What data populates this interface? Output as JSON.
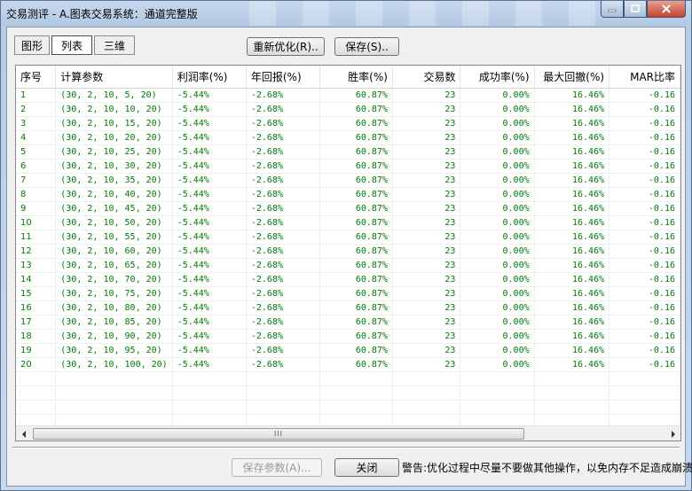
{
  "window": {
    "title": "交易测评 - A.图表交易系统：通道完整版"
  },
  "tabs": [
    {
      "label": "图形",
      "active": false
    },
    {
      "label": "列表",
      "active": true
    },
    {
      "label": "三维",
      "active": false
    }
  ],
  "toolbar": {
    "reoptimize_label": "重新优化(R)..",
    "save_label": "保存(S).."
  },
  "table": {
    "columns": [
      "序号",
      "计算参数",
      "利润率(%)",
      "年回报(%)",
      "胜率(%)",
      "交易数",
      "成功率(%)",
      "最大回撤(%)",
      "MAR比率"
    ],
    "rows": [
      [
        "1",
        "(30, 2, 10, 5, 20)",
        "-5.44%",
        "-2.68%",
        "60.87%",
        "23",
        "0.00%",
        "16.46%",
        "-0.16"
      ],
      [
        "2",
        "(30, 2, 10, 10, 20)",
        "-5.44%",
        "-2.68%",
        "60.87%",
        "23",
        "0.00%",
        "16.46%",
        "-0.16"
      ],
      [
        "3",
        "(30, 2, 10, 15, 20)",
        "-5.44%",
        "-2.68%",
        "60.87%",
        "23",
        "0.00%",
        "16.46%",
        "-0.16"
      ],
      [
        "4",
        "(30, 2, 10, 20, 20)",
        "-5.44%",
        "-2.68%",
        "60.87%",
        "23",
        "0.00%",
        "16.46%",
        "-0.16"
      ],
      [
        "5",
        "(30, 2, 10, 25, 20)",
        "-5.44%",
        "-2.68%",
        "60.87%",
        "23",
        "0.00%",
        "16.46%",
        "-0.16"
      ],
      [
        "6",
        "(30, 2, 10, 30, 20)",
        "-5.44%",
        "-2.68%",
        "60.87%",
        "23",
        "0.00%",
        "16.46%",
        "-0.16"
      ],
      [
        "7",
        "(30, 2, 10, 35, 20)",
        "-5.44%",
        "-2.68%",
        "60.87%",
        "23",
        "0.00%",
        "16.46%",
        "-0.16"
      ],
      [
        "8",
        "(30, 2, 10, 40, 20)",
        "-5.44%",
        "-2.68%",
        "60.87%",
        "23",
        "0.00%",
        "16.46%",
        "-0.16"
      ],
      [
        "9",
        "(30, 2, 10, 45, 20)",
        "-5.44%",
        "-2.68%",
        "60.87%",
        "23",
        "0.00%",
        "16.46%",
        "-0.16"
      ],
      [
        "10",
        "(30, 2, 10, 50, 20)",
        "-5.44%",
        "-2.68%",
        "60.87%",
        "23",
        "0.00%",
        "16.46%",
        "-0.16"
      ],
      [
        "11",
        "(30, 2, 10, 55, 20)",
        "-5.44%",
        "-2.68%",
        "60.87%",
        "23",
        "0.00%",
        "16.46%",
        "-0.16"
      ],
      [
        "12",
        "(30, 2, 10, 60, 20)",
        "-5.44%",
        "-2.68%",
        "60.87%",
        "23",
        "0.00%",
        "16.46%",
        "-0.16"
      ],
      [
        "13",
        "(30, 2, 10, 65, 20)",
        "-5.44%",
        "-2.68%",
        "60.87%",
        "23",
        "0.00%",
        "16.46%",
        "-0.16"
      ],
      [
        "14",
        "(30, 2, 10, 70, 20)",
        "-5.44%",
        "-2.68%",
        "60.87%",
        "23",
        "0.00%",
        "16.46%",
        "-0.16"
      ],
      [
        "15",
        "(30, 2, 10, 75, 20)",
        "-5.44%",
        "-2.68%",
        "60.87%",
        "23",
        "0.00%",
        "16.46%",
        "-0.16"
      ],
      [
        "16",
        "(30, 2, 10, 80, 20)",
        "-5.44%",
        "-2.68%",
        "60.87%",
        "23",
        "0.00%",
        "16.46%",
        "-0.16"
      ],
      [
        "17",
        "(30, 2, 10, 85, 20)",
        "-5.44%",
        "-2.68%",
        "60.87%",
        "23",
        "0.00%",
        "16.46%",
        "-0.16"
      ],
      [
        "18",
        "(30, 2, 10, 90, 20)",
        "-5.44%",
        "-2.68%",
        "60.87%",
        "23",
        "0.00%",
        "16.46%",
        "-0.16"
      ],
      [
        "19",
        "(30, 2, 10, 95, 20)",
        "-5.44%",
        "-2.68%",
        "60.87%",
        "23",
        "0.00%",
        "16.46%",
        "-0.16"
      ],
      [
        "20",
        "(30, 2, 10, 100, 20)",
        "-5.44%",
        "-2.68%",
        "60.87%",
        "23",
        "0.00%",
        "16.46%",
        "-0.16"
      ]
    ]
  },
  "scrollbar": {
    "left_icon": "scroll-left-arrow-icon",
    "right_icon": "scroll-right-arrow-icon",
    "grip": "III"
  },
  "footer": {
    "save_params_label": "保存参数(A)...",
    "close_label": "关闭",
    "warning": "警告:优化过程中尽量不要做其他操作，以免内存不足造成崩溃"
  },
  "colors": {
    "value_text": "#007a00",
    "titlebar": "#b3c9e3",
    "close_button": "#c2452e"
  }
}
